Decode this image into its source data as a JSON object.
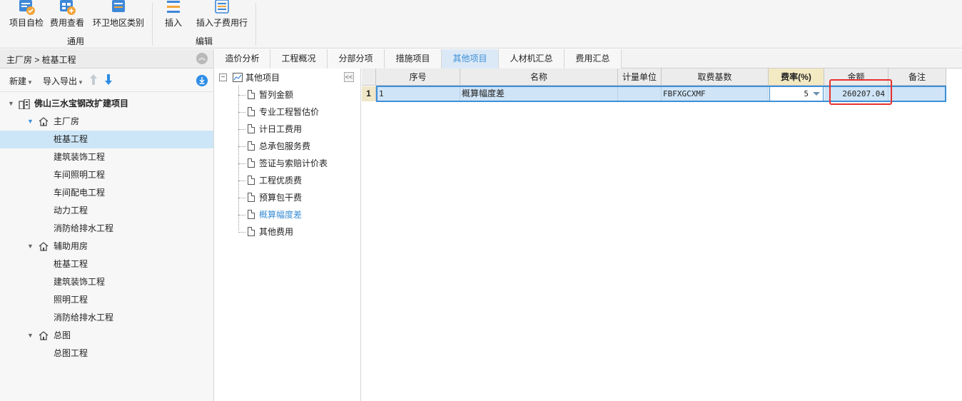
{
  "ribbon": {
    "groups": [
      {
        "label": "通用",
        "buttons": [
          "项目自检",
          "费用查看",
          "环卫地区类别"
        ]
      },
      {
        "label": "编辑",
        "buttons": [
          "插入",
          "插入子费用行"
        ]
      }
    ]
  },
  "left_panel": {
    "breadcrumb": "主厂房 > 桩基工程",
    "toolbar": {
      "new_label": "新建",
      "import_export_label": "导入导出"
    },
    "tree": [
      {
        "label": "佛山三水宝钢改扩建项目",
        "level": 0
      },
      {
        "label": "主厂房",
        "level": 1
      },
      {
        "label": "桩基工程",
        "level": 2,
        "selected": true
      },
      {
        "label": "建筑装饰工程",
        "level": 2
      },
      {
        "label": "车间照明工程",
        "level": 2
      },
      {
        "label": "车间配电工程",
        "level": 2
      },
      {
        "label": "动力工程",
        "level": 2
      },
      {
        "label": "消防给排水工程",
        "level": 2
      },
      {
        "label": "辅助用房",
        "level": 1
      },
      {
        "label": "桩基工程",
        "level": 2
      },
      {
        "label": "建筑装饰工程",
        "level": 2
      },
      {
        "label": "照明工程",
        "level": 2
      },
      {
        "label": "消防给排水工程",
        "level": 2
      },
      {
        "label": "总图",
        "level": 1
      },
      {
        "label": "总图工程",
        "level": 2
      }
    ]
  },
  "tabs": [
    {
      "label": "造价分析"
    },
    {
      "label": "工程概况"
    },
    {
      "label": "分部分项"
    },
    {
      "label": "措施项目"
    },
    {
      "label": "其他项目",
      "active": true
    },
    {
      "label": "人材机汇总"
    },
    {
      "label": "费用汇总"
    }
  ],
  "other_items_tree": {
    "root": "其他项目",
    "collapse_glyph": "<<",
    "items": [
      {
        "label": "暂列金额"
      },
      {
        "label": "专业工程暂估价"
      },
      {
        "label": "计日工费用"
      },
      {
        "label": "总承包服务费"
      },
      {
        "label": "签证与索赔计价表"
      },
      {
        "label": "工程优质费"
      },
      {
        "label": "预算包干费"
      },
      {
        "label": "概算幅度差",
        "selected": true
      },
      {
        "label": "其他费用"
      }
    ]
  },
  "grid": {
    "columns": [
      "序号",
      "名称",
      "计量单位",
      "取费基数",
      "费率(%)",
      "金额",
      "备注"
    ],
    "rows": [
      {
        "rownum": "1",
        "seq": "1",
        "name": "概算幅度差",
        "unit": "",
        "base": "FBFXGCXMF",
        "rate": "5",
        "amount": "260207.04",
        "note": ""
      }
    ]
  },
  "colors": {
    "accent": "#3c8fd6",
    "selection": "#cfe4f7",
    "highlight_mark": "#e8302d"
  }
}
